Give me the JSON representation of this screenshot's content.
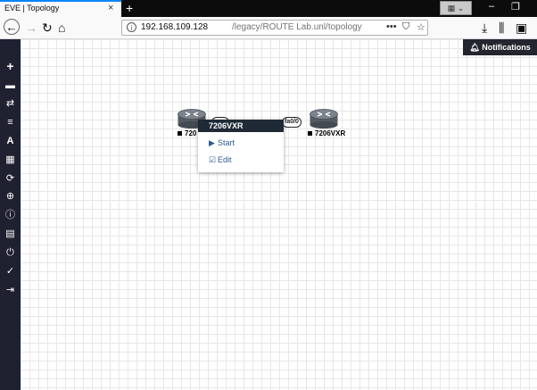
{
  "browser": {
    "tab_title": "EVE | Topology",
    "tab_close": "×",
    "new_tab": "+",
    "url_host": "192.168.109.128",
    "url_path": "/legacy/ROUTE Lab.unl/topology"
  },
  "app": {
    "notifications_label": "Notifications",
    "sidebar_icons": [
      "add-icon",
      "nodes-icon",
      "networks-icon",
      "startup-configs-icon",
      "text-icon",
      "grid-icon",
      "refresh-icon",
      "zoom-icon",
      "status-icon",
      "lab-details-icon",
      "close-lab-icon",
      "lock-icon",
      "logout-icon"
    ],
    "nodes": [
      {
        "name": "7206VXR",
        "label_visible": "720"
      },
      {
        "name": "7206VXR",
        "label_visible": "7206VXR"
      }
    ],
    "link": {
      "port_left": "",
      "port_right": "fa0/0"
    },
    "context_menu": {
      "title": "7206VXR",
      "start_label": "Start",
      "edit_label": "Edit"
    }
  }
}
